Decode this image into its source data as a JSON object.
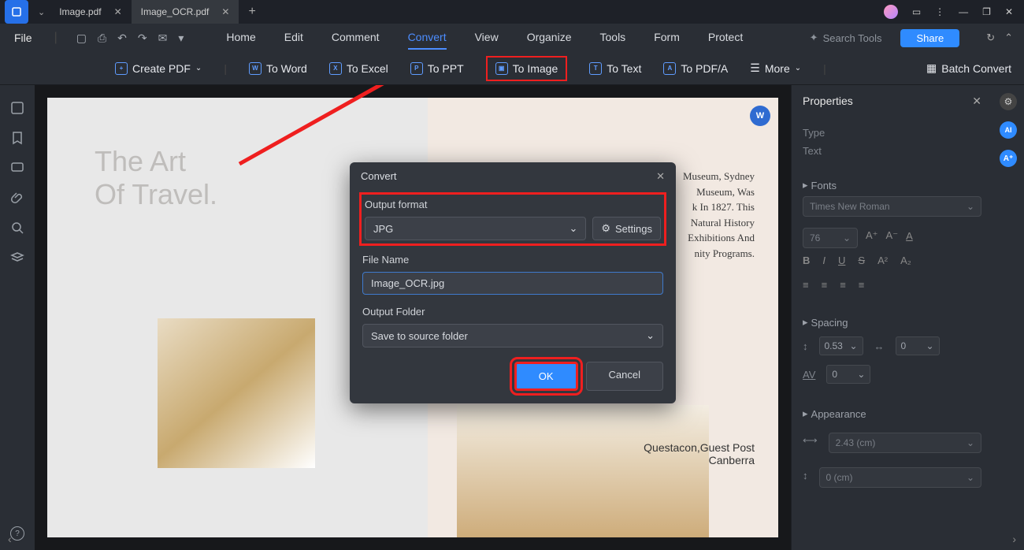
{
  "titlebar": {
    "tabs": [
      {
        "name": "Image.pdf"
      },
      {
        "name": "Image_OCR.pdf"
      }
    ]
  },
  "menubar": {
    "file": "File",
    "tabs": [
      "Home",
      "Edit",
      "Comment",
      "Convert",
      "View",
      "Organize",
      "Tools",
      "Form",
      "Protect"
    ],
    "search": "Search Tools",
    "share": "Share"
  },
  "convert_tb": {
    "create": "Create PDF",
    "to_word": "To Word",
    "to_excel": "To Excel",
    "to_ppt": "To PPT",
    "to_image": "To Image",
    "to_text": "To Text",
    "to_pdfa": "To PDF/A",
    "more": "More",
    "batch": "Batch Convert"
  },
  "page": {
    "title_line1": "The Art",
    "title_line2": "Of Travel.",
    "museum_text": "Museum, Sydney\nMuseum, Was\nk In 1827. This\nNatural History\nExhibitions And\nnity Programs.",
    "quest1": "Questacon,Guest Post",
    "quest2": "Canberra"
  },
  "dialog": {
    "title": "Convert",
    "output_format_label": "Output format",
    "output_format_value": "JPG",
    "settings": "Settings",
    "file_name_label": "File Name",
    "file_name_value": "Image_OCR.jpg",
    "output_folder_label": "Output Folder",
    "output_folder_value": "Save to source folder",
    "ok": "OK",
    "cancel": "Cancel"
  },
  "props": {
    "title": "Properties",
    "type_label": "Type",
    "text_label": "Text",
    "fonts_label": "Fonts",
    "font_value": "Times New Roman",
    "font_size": "76",
    "spacing_label": "Spacing",
    "line_spacing": "0.53",
    "before": "0",
    "after": "0",
    "appearance_label": "Appearance",
    "width": "2.43 (cm)",
    "height": "0 (cm)"
  }
}
